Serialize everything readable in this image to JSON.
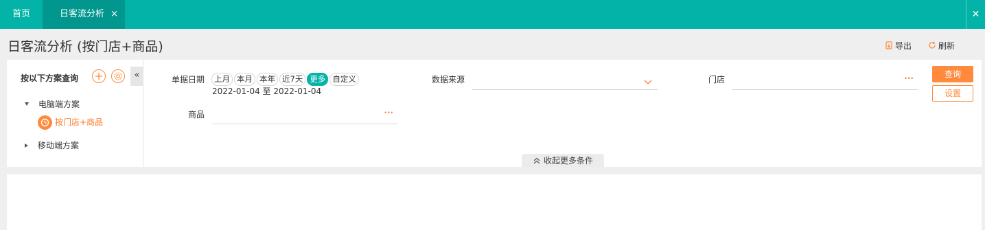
{
  "tabs": {
    "home_label": "首页",
    "active_label": "日客流分析",
    "active_close": "×",
    "bar_close": "✕"
  },
  "page": {
    "title": "日客流分析 (按门店+商品)",
    "export_label": "导出",
    "refresh_label": "刷新"
  },
  "scheme": {
    "header": "按以下方案查询",
    "collapse_label": "«",
    "groups": [
      {
        "label": "电脑端方案",
        "expanded": true
      },
      {
        "label": "移动端方案",
        "expanded": false
      }
    ],
    "active_item": "按门店+商品"
  },
  "filters": {
    "date_label": "单据日期",
    "date_chips": [
      "上月",
      "本月",
      "本年",
      "近7天",
      "更多",
      "自定义"
    ],
    "date_chip_selected": "更多",
    "date_range": "2022-01-04 至 2022-01-04",
    "source_label": "数据来源",
    "source_value": "",
    "store_label": "门店",
    "store_value": "",
    "goods_label": "商品",
    "goods_value": "",
    "more_icon": "···"
  },
  "actions": {
    "query_label": "查询",
    "setting_label": "设置",
    "collapse_more_label": "收起更多条件"
  },
  "colors": {
    "teal": "#03b3a8",
    "teal_dark": "#02978e",
    "orange": "#ff8a3d"
  }
}
